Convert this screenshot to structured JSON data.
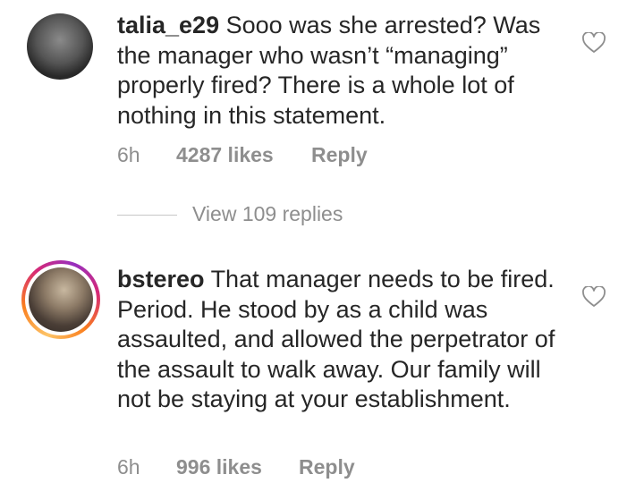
{
  "comments": [
    {
      "username": "talia_e29",
      "text": "Sooo was she arrested? Was the manager who wasn’t “managing” properly fired? There is a whole lot of nothing in this statement.",
      "time": "6h",
      "likes": "4287 likes",
      "reply": "Reply",
      "view_replies": "View 109 replies",
      "avatar_icon": "profile-photo",
      "like_icon": "heart-outline-icon"
    },
    {
      "username": "bstereo",
      "text": "That manager needs to be fired. Period. He stood by as a child was assaulted, and allowed the perpetrator of the assault to walk away. Our family will not be staying at your establishment.",
      "time": "6h",
      "likes": "996 likes",
      "reply": "Reply",
      "avatar_icon": "profile-photo-story-ring",
      "like_icon": "heart-outline-icon"
    }
  ],
  "colors": {
    "text": "#262626",
    "meta": "#8e8e8e",
    "divider": "#c7c7c7",
    "story_ring": [
      "#fdc468",
      "#fa7e1e",
      "#d62976",
      "#962fbf"
    ]
  }
}
